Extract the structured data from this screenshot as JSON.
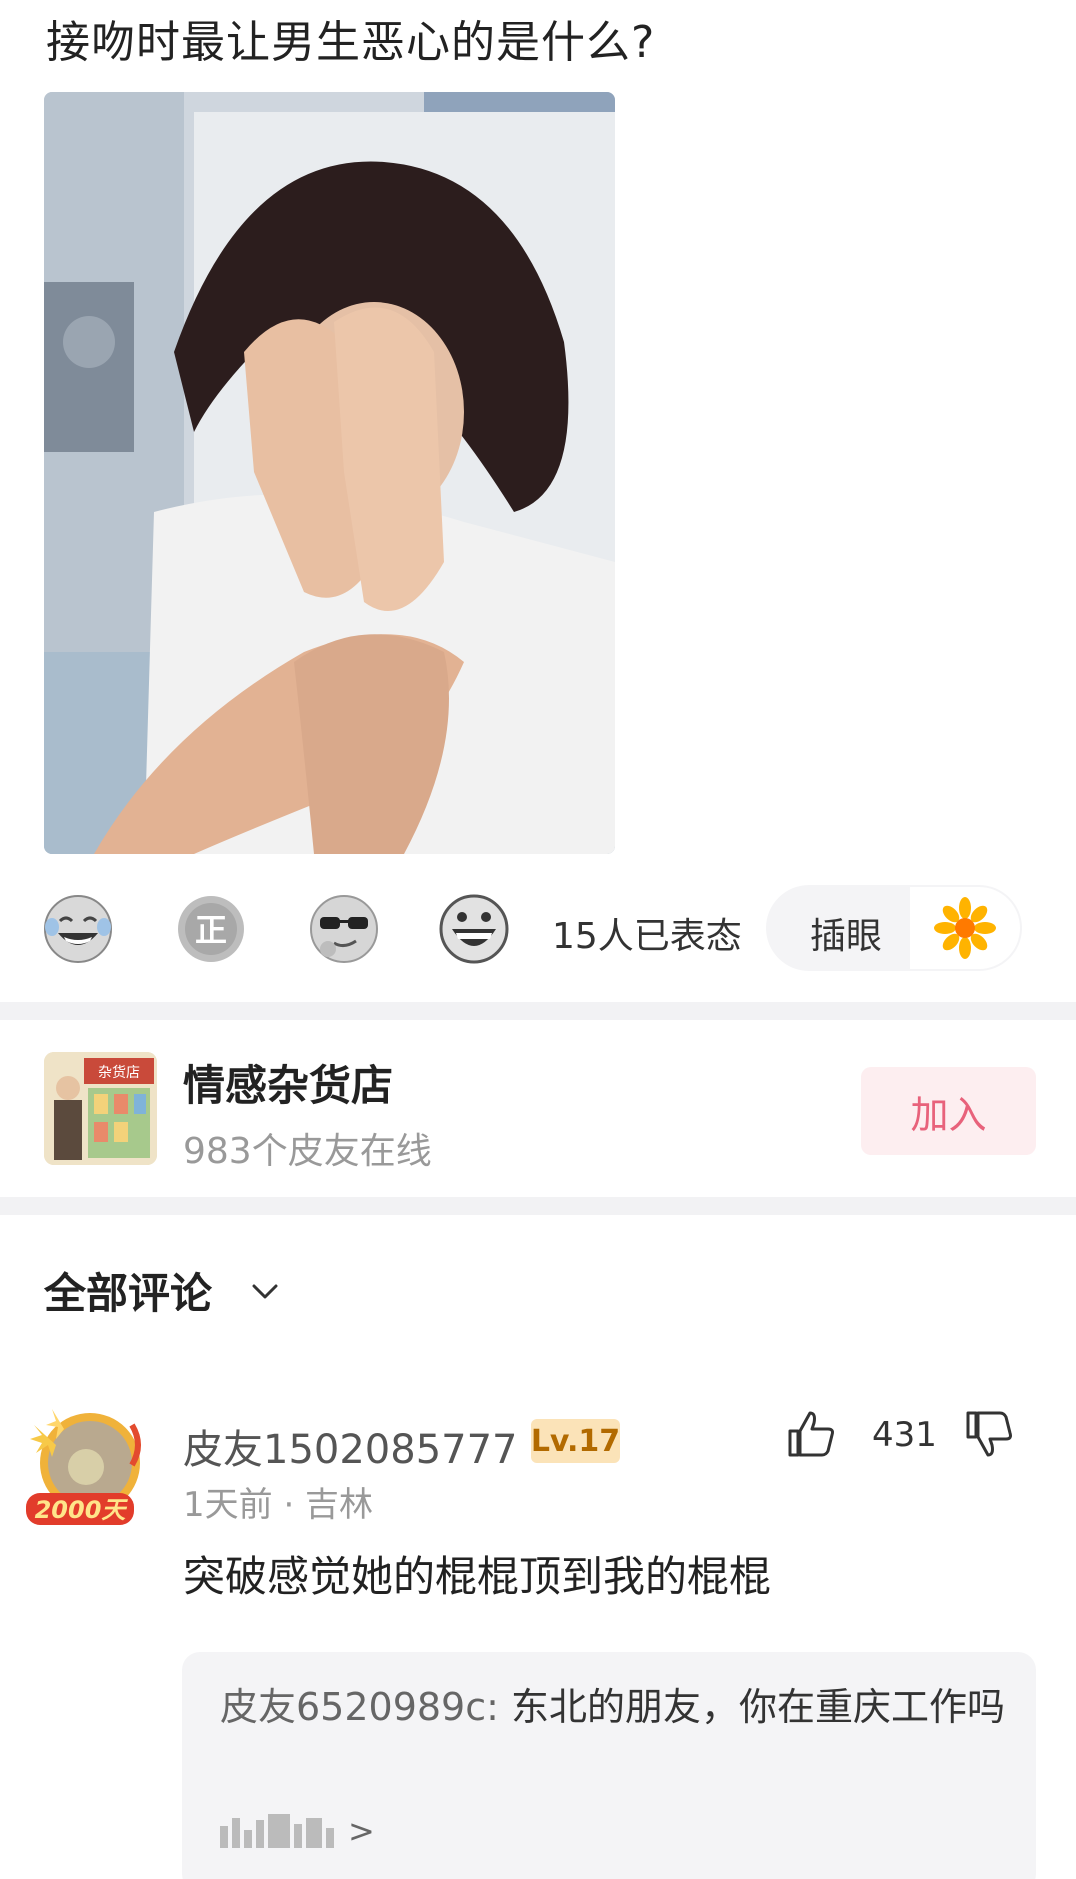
{
  "post": {
    "title": "接吻时最让男生恶心的是什么?"
  },
  "reactions": {
    "emojis": [
      "laughing-tears-emoji",
      "zheng-badge-emoji",
      "sunglasses-emoji",
      "grinning-emoji"
    ],
    "count_text": "15人已表态",
    "pill_label": "插眼",
    "pill_icon": "sunflower-icon"
  },
  "group": {
    "name": "情感杂货店",
    "online": "983个皮友在线",
    "join_label": "加入",
    "avatar_sign": "杂货店"
  },
  "comments": {
    "header": "全部评论",
    "items": [
      {
        "user": "皮友1502085777",
        "level": "Lv.17",
        "meta": "1天前 · 吉林",
        "text": "突破感觉她的棍棍顶到我的棍棍",
        "likes": "431",
        "avatar_badge": "2000天",
        "reply": {
          "user": "皮友6520989c",
          "separator": ":",
          "text": "东北的朋友，你在重庆工作吗",
          "more_arrow": ">"
        }
      }
    ]
  },
  "colors": {
    "accent_pink": "#e8627b",
    "join_bg": "#fdeef0",
    "level_bg": "#fbe3b8",
    "level_text": "#b26a00",
    "divider": "#f2f2f4"
  }
}
